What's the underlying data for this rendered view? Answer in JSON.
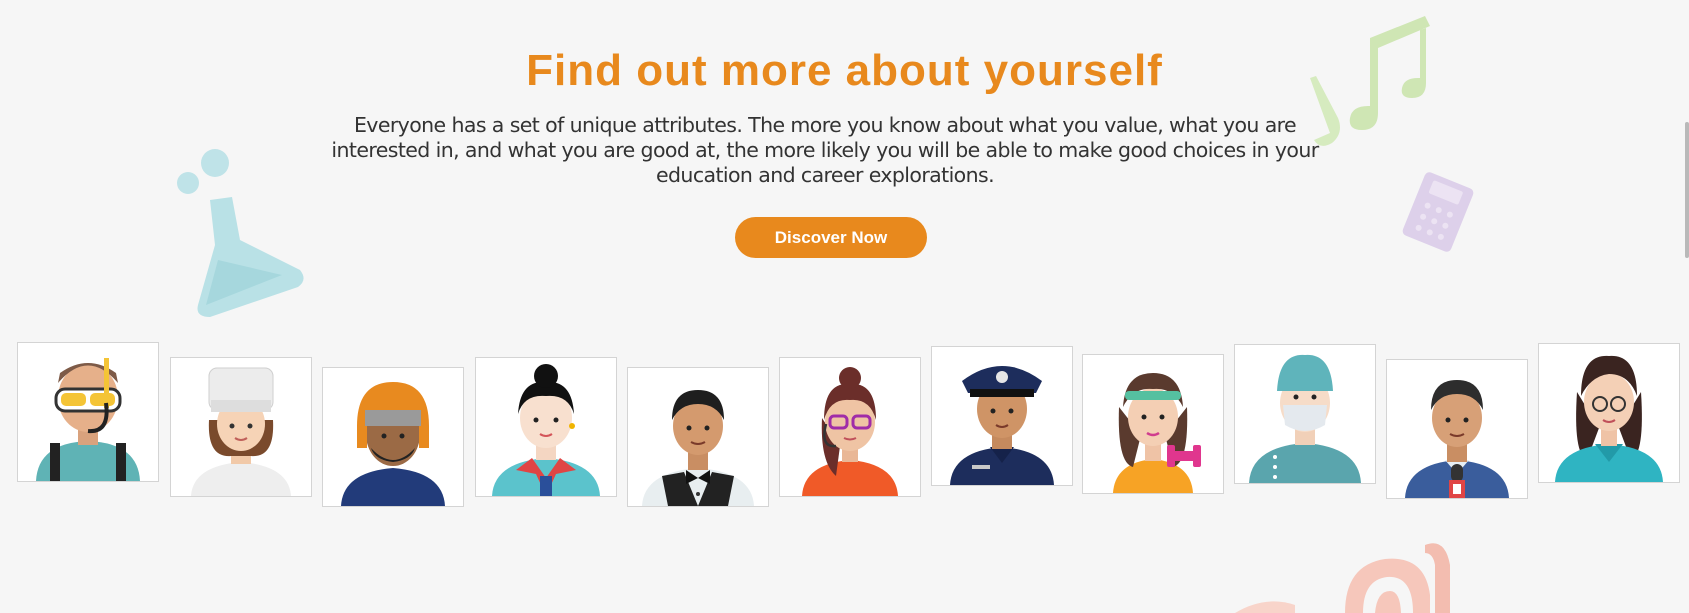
{
  "hero": {
    "title": "Find out more about yourself",
    "description": "Everyone has a set of unique attributes. The more you know about what you value, what you are interested in, and what you are good at, the more likely you will be able to make good choices in your education and career explorations.",
    "cta_label": "Discover Now"
  },
  "colors": {
    "accent": "#e8891d",
    "background": "#f6f6f6",
    "text": "#333333"
  },
  "decorations": [
    "flask-icon",
    "music-notes-icon",
    "calculator-icon",
    "swirl-icon"
  ],
  "avatars": [
    {
      "name": "diver-avatar"
    },
    {
      "name": "chef-avatar"
    },
    {
      "name": "delivery-rider-avatar"
    },
    {
      "name": "flight-attendant-avatar"
    },
    {
      "name": "waiter-avatar"
    },
    {
      "name": "call-center-agent-avatar"
    },
    {
      "name": "police-officer-avatar"
    },
    {
      "name": "fitness-instructor-avatar"
    },
    {
      "name": "surgeon-avatar"
    },
    {
      "name": "reporter-avatar"
    },
    {
      "name": "nurse-avatar"
    }
  ]
}
